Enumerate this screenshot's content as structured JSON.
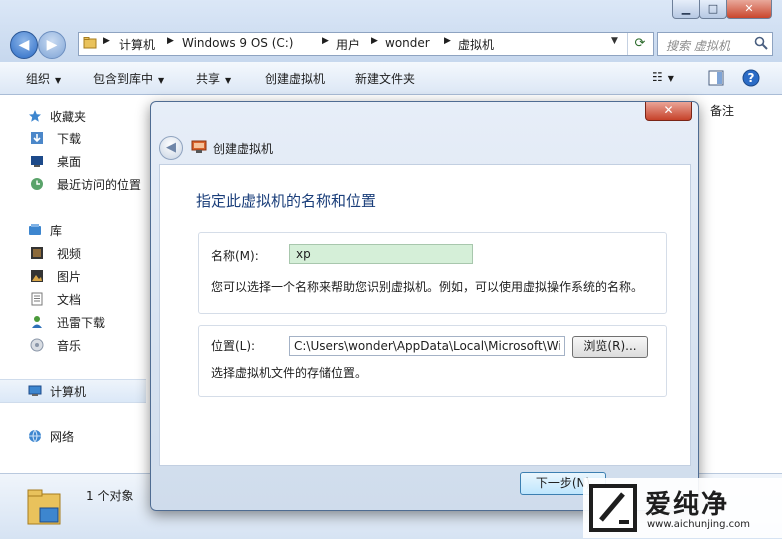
{
  "explorer": {
    "breadcrumbs": [
      "计算机",
      "Windows 9 OS (C:)",
      "用户",
      "wonder",
      "虚拟机"
    ],
    "search_placeholder": "搜索 虚拟机",
    "toolbar": {
      "organize": "组织",
      "include_in_library": "包含到库中",
      "share": "共享",
      "create_vm": "创建虚拟机",
      "new_folder": "新建文件夹"
    },
    "sidebar": {
      "favorites": "收藏夹",
      "downloads": "下载",
      "desktop": "桌面",
      "recent": "最近访问的位置",
      "libraries": "库",
      "videos": "视频",
      "pictures": "图片",
      "documents": "文档",
      "thunder": "迅雷下载",
      "music": "音乐",
      "computer": "计算机",
      "network": "网络"
    },
    "column_note": "备注",
    "status_text": "1 个对象"
  },
  "dialog": {
    "title": "创建虚拟机",
    "heading": "指定此虚拟机的名称和位置",
    "name_label": "名称(M):",
    "name_value": "xp",
    "name_hint": "您可以选择一个名称来帮助您识别虚拟机。例如，可以使用虚拟操作系统的名称。",
    "location_label": "位置(L):",
    "location_value": "C:\\Users\\wonder\\AppData\\Local\\Microsoft\\Windows Virtual PC",
    "browse_label": "浏览(R)...",
    "location_hint": "选择虚拟机文件的存储位置。",
    "next_label": "下一步(N)"
  },
  "watermark": {
    "name": "爱纯净",
    "url": "www.aichunjing.com"
  },
  "colors": {
    "name_field_bg": "#d5efd8",
    "close_button": "#c6422a",
    "heading": "#1a3e7a"
  }
}
